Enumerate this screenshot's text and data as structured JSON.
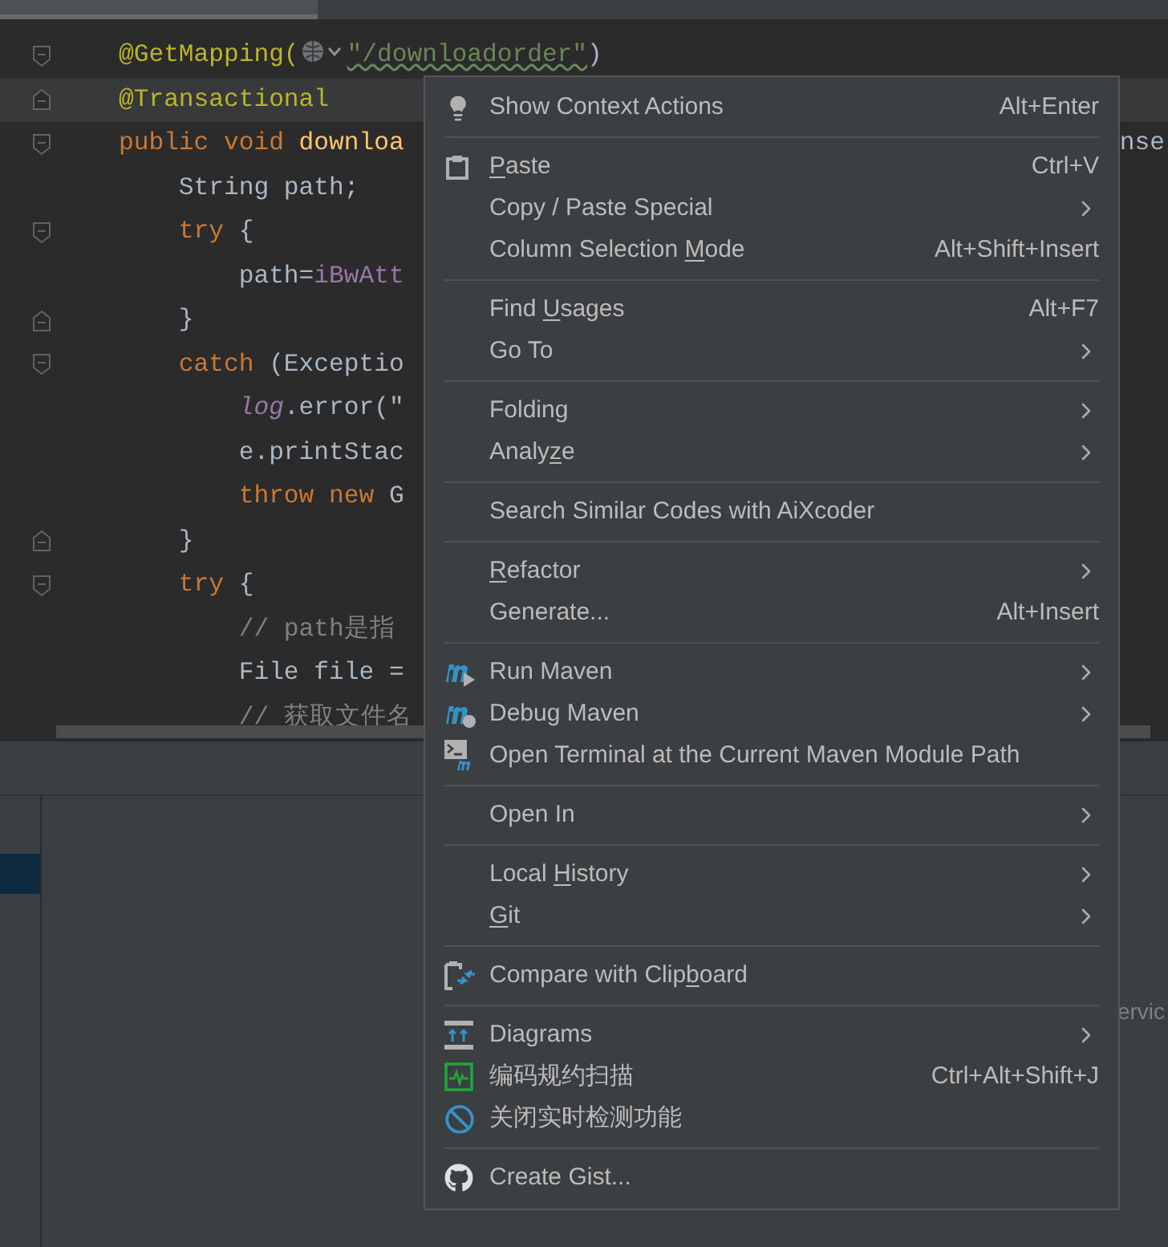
{
  "editor": {
    "lines": [
      {
        "kind": "foldstart",
        "current": false,
        "tokens": [
          {
            "kind": "annotation",
            "text": "@GetMapping("
          },
          {
            "kind": "icon"
          },
          {
            "kind": "string",
            "text": "\"/downloadorder\""
          },
          {
            "kind": "plain",
            "text": ")"
          }
        ]
      },
      {
        "kind": "foldend",
        "current": true,
        "tokens": [
          {
            "kind": "annotation",
            "text": "@Transactional"
          }
        ]
      },
      {
        "kind": "foldstart",
        "current": false,
        "tokens": [
          {
            "kind": "keyword",
            "text": "public void "
          },
          {
            "kind": "method",
            "text": "downloa"
          }
        ],
        "tail": "nse"
      },
      {
        "kind": "plain",
        "current": false,
        "tokens": [
          {
            "kind": "plain",
            "text": "    String path;"
          }
        ]
      },
      {
        "kind": "foldstart",
        "current": false,
        "tokens": [
          {
            "kind": "keyword",
            "text": "    try "
          },
          {
            "kind": "plain",
            "text": "{"
          }
        ]
      },
      {
        "kind": "plain",
        "current": false,
        "tokens": [
          {
            "kind": "plain",
            "text": "        path="
          },
          {
            "kind": "field",
            "text": "iBwAtt"
          }
        ]
      },
      {
        "kind": "foldend",
        "current": false,
        "tokens": [
          {
            "kind": "plain",
            "text": "    }"
          }
        ]
      },
      {
        "kind": "foldstart",
        "current": false,
        "tokens": [
          {
            "kind": "keyword",
            "text": "    catch "
          },
          {
            "kind": "plain",
            "text": "(Exceptio"
          }
        ]
      },
      {
        "kind": "plain",
        "current": false,
        "tokens": [
          {
            "kind": "static",
            "text": "        log"
          },
          {
            "kind": "plain",
            "text": ".error(\""
          }
        ]
      },
      {
        "kind": "plain",
        "current": false,
        "tokens": [
          {
            "kind": "plain",
            "text": "        e.printStac"
          }
        ]
      },
      {
        "kind": "plain",
        "current": false,
        "tokens": [
          {
            "kind": "keyword",
            "text": "        throw new "
          },
          {
            "kind": "plain",
            "text": "G"
          }
        ]
      },
      {
        "kind": "foldend",
        "current": false,
        "tokens": [
          {
            "kind": "plain",
            "text": "    }"
          }
        ]
      },
      {
        "kind": "foldstart",
        "current": false,
        "tokens": [
          {
            "kind": "keyword",
            "text": "    try "
          },
          {
            "kind": "plain",
            "text": "{"
          }
        ]
      },
      {
        "kind": "plain",
        "current": false,
        "tokens": [
          {
            "kind": "comment",
            "text": "        // path是指"
          }
        ]
      },
      {
        "kind": "plain",
        "current": false,
        "tokens": [
          {
            "kind": "plain",
            "text": "        File file ="
          }
        ]
      },
      {
        "kind": "plain",
        "current": false,
        "tokens": [
          {
            "kind": "comment",
            "text": "        // 获取文件名"
          }
        ]
      }
    ]
  },
  "bottom_panel": {
    "rows": [
      {
        "selected": true
      }
    ],
    "partial_text": "ervic"
  },
  "context_menu": {
    "groups": [
      {
        "items": [
          {
            "kind": "bulb",
            "label": [
              {
                "text": "Show Context Actions",
                "underlined": false
              }
            ],
            "shortcut": "Alt+Enter",
            "submenu": false
          }
        ]
      },
      {
        "items": [
          {
            "kind": "clipboard",
            "label": [
              {
                "text": "P",
                "underlined": true
              },
              {
                "text": "aste",
                "underlined": false
              }
            ],
            "shortcut": "Ctrl+V",
            "submenu": false
          },
          {
            "kind": "plain",
            "label": [
              {
                "text": "Copy / Paste Special",
                "underlined": false
              }
            ],
            "submenu": true
          },
          {
            "kind": "plain",
            "label": [
              {
                "text": "Column Selection ",
                "underlined": false
              },
              {
                "text": "M",
                "underlined": true
              },
              {
                "text": "ode",
                "underlined": false
              }
            ],
            "shortcut": "Alt+Shift+Insert",
            "submenu": false
          }
        ]
      },
      {
        "items": [
          {
            "kind": "plain",
            "label": [
              {
                "text": "Find ",
                "underlined": false
              },
              {
                "text": "U",
                "underlined": true
              },
              {
                "text": "sages",
                "underlined": false
              }
            ],
            "shortcut": "Alt+F7",
            "submenu": false
          },
          {
            "kind": "plain",
            "label": [
              {
                "text": "Go To",
                "underlined": false
              }
            ],
            "submenu": true
          }
        ]
      },
      {
        "items": [
          {
            "kind": "plain",
            "label": [
              {
                "text": "Folding",
                "underlined": false
              }
            ],
            "submenu": true
          },
          {
            "kind": "plain",
            "label": [
              {
                "text": "Analy",
                "underlined": false
              },
              {
                "text": "z",
                "underlined": true
              },
              {
                "text": "e",
                "underlined": false
              }
            ],
            "submenu": true
          }
        ]
      },
      {
        "items": [
          {
            "kind": "plain",
            "label": [
              {
                "text": "Search Similar Codes with AiXcoder",
                "underlined": false
              }
            ],
            "submenu": false
          }
        ]
      },
      {
        "items": [
          {
            "kind": "plain",
            "label": [
              {
                "text": "R",
                "underlined": true
              },
              {
                "text": "efactor",
                "underlined": false
              }
            ],
            "submenu": true
          },
          {
            "kind": "plain",
            "label": [
              {
                "text": "Generate...",
                "underlined": false
              }
            ],
            "shortcut": "Alt+Insert",
            "submenu": false
          }
        ]
      },
      {
        "items": [
          {
            "kind": "mavenrun",
            "label": [
              {
                "text": "Run Maven",
                "underlined": false
              }
            ],
            "submenu": true
          },
          {
            "kind": "mavendebug",
            "label": [
              {
                "text": "Debug Maven",
                "underlined": false
              }
            ],
            "submenu": true
          },
          {
            "kind": "terminal",
            "label": [
              {
                "text": "Open Terminal at the Current Maven Module Path",
                "underlined": false
              }
            ],
            "submenu": false
          }
        ]
      },
      {
        "items": [
          {
            "kind": "plain",
            "label": [
              {
                "text": "Open In",
                "underlined": false
              }
            ],
            "submenu": true
          }
        ]
      },
      {
        "items": [
          {
            "kind": "plain",
            "label": [
              {
                "text": "Local ",
                "underlined": false
              },
              {
                "text": "H",
                "underlined": true
              },
              {
                "text": "istory",
                "underlined": false
              }
            ],
            "submenu": true
          },
          {
            "kind": "plain",
            "label": [
              {
                "text": "G",
                "underlined": true
              },
              {
                "text": "it",
                "underlined": false
              }
            ],
            "submenu": true
          }
        ]
      },
      {
        "items": [
          {
            "kind": "compare",
            "label": [
              {
                "text": "Compare with Clip",
                "underlined": false
              },
              {
                "text": "b",
                "underlined": true
              },
              {
                "text": "oard",
                "underlined": false
              }
            ],
            "submenu": false
          }
        ]
      },
      {
        "items": [
          {
            "kind": "diagram",
            "label": [
              {
                "text": "Diagrams",
                "underlined": false
              }
            ],
            "submenu": true
          },
          {
            "kind": "scan",
            "label": [
              {
                "text": "编码规约扫描",
                "underlined": false
              }
            ],
            "shortcut": "Ctrl+Alt+Shift+J",
            "submenu": false
          },
          {
            "kind": "ban",
            "label": [
              {
                "text": "关闭实时检测功能",
                "underlined": false
              }
            ],
            "submenu": false
          }
        ]
      },
      {
        "items": [
          {
            "kind": "github",
            "label": [
              {
                "text": "Create Gist...",
                "underlined": false
              }
            ],
            "submenu": false
          }
        ]
      }
    ]
  }
}
